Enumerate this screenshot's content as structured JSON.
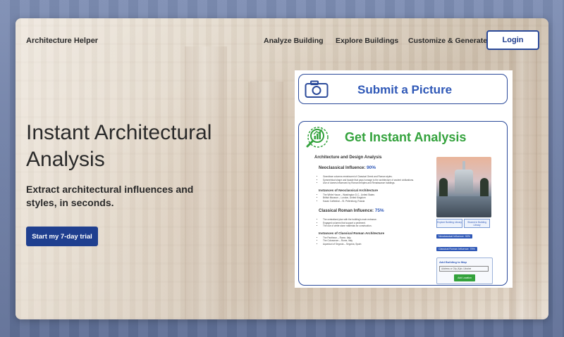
{
  "brand": "Architecture Helper",
  "nav": [
    "Analyze Building",
    "Explore Buildings",
    "Customize & Generate"
  ],
  "login_label": "Login",
  "hero": {
    "title": "Instant Architectural Analysis",
    "subtitle": "Extract architectural influences and styles, in seconds.",
    "cta": "Start my 7-day trial"
  },
  "panel": {
    "submit_text": "Submit a Picture",
    "analysis_text": "Get Instant Analysis",
    "doc_heading": "Architecture and Design Analysis",
    "influence1": {
      "label": "Neoclassical Influence:",
      "pct": "90%"
    },
    "influence1_bullets": [
      "Grandiose columns reminiscent of Classical Greek and Roman styles.",
      "Symmetrical shape and facade that pays homage to the architecture of ancient civilizations.",
      "Use of domes influenced by Roman temples and Renaissance buildings."
    ],
    "instances1_heading": "Instances of Neoclassical Architecture",
    "instances1": [
      "The White House – Washington D.C., United States",
      "British Museum – London, United Kingdom",
      "Kazan Cathedral – St. Petersburg, Russia"
    ],
    "influence2": {
      "label": "Classical Roman Influence:",
      "pct": "75%"
    },
    "influence2_bullets": [
      "The centralized plan with the building's main entrance.",
      "Engaged columns that support a pediment.",
      "The use of white stone materials for construction."
    ],
    "instances2_heading": "Instances of Classical Roman Architecture",
    "instances2": [
      "The Pantheon – Rome, Italy",
      "The Colosseum – Rome, Italy",
      "Aqueduct of Segovia – Segovia, Spain"
    ],
    "btn_explore": "Explore Building Library",
    "btn_shared": "Shared in Building Library",
    "tag1": "Neoclassical Influence: 90%",
    "tag2": "Classical Roman Influence: 75%",
    "map_title": "Add Building to Map",
    "map_input": "Address or City (Kyiv, Ukraine",
    "map_button": "Add Location"
  },
  "colors": {
    "accent": "#2f58b7",
    "cta": "#1f3f8f",
    "green": "#33a23c"
  }
}
